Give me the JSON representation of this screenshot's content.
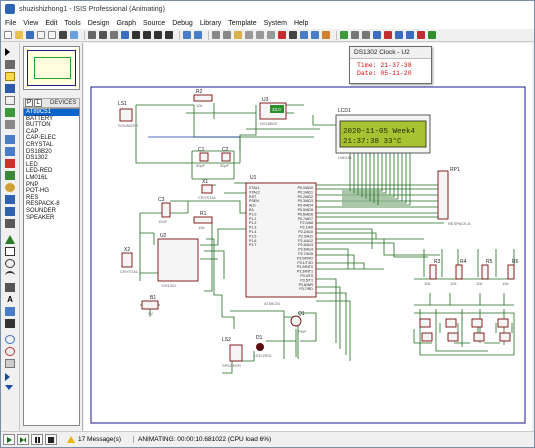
{
  "window": {
    "title": "shuzishizhong1 - ISIS Professional (Animating)"
  },
  "menu": [
    "File",
    "View",
    "Edit",
    "Tools",
    "Design",
    "Graph",
    "Source",
    "Debug",
    "Library",
    "Template",
    "System",
    "Help"
  ],
  "device_panel": {
    "p_label": "P",
    "l_label": "L",
    "title": "DEVICES",
    "items": [
      "AT89C51",
      "BATTERY",
      "BUTTON",
      "CAP",
      "CAP-ELEC",
      "CRYSTAL",
      "DS18B20",
      "DS1302",
      "LED",
      "LED-RED",
      "LM016L",
      "PNP",
      "POT-HG",
      "RES",
      "RESPACK-8",
      "SOUNDER",
      "SPEAKER"
    ],
    "selected": "AT89C51"
  },
  "popup": {
    "title": "DS1302 Clock - U2",
    "time_line": "Time: 21-37-38",
    "date_line": "Date: 05-11-20"
  },
  "lcd": {
    "label": "LCD1",
    "part": "LM016L",
    "line1": "2020-11-05 Week4",
    "line2": "21:37:38    33°C"
  },
  "components": {
    "ls1": "LS1",
    "ls1_part": "SOUNDER",
    "r2": "R2",
    "r2_val": "10k",
    "u3": "U3",
    "u3_part": "DS18B20",
    "u3_reading": "33.0",
    "u1": "U1",
    "u1_part": "AT89C51",
    "u2": "U2",
    "u2_part": "DS1302",
    "x1": "X1",
    "x1_part": "CRYSTAL",
    "x2": "X2",
    "x2_part": "CRYSTAL",
    "c1": "C1",
    "c1_val": "30pF",
    "c2": "C2",
    "c2_val": "30pF",
    "c3": "C3",
    "c3_val": "10uF",
    "r1": "R1",
    "r1_val": "10k",
    "b1": "B1",
    "b1_val": "3V",
    "ls2": "LS2",
    "ls2_part": "SPEAKER",
    "d1": "D1",
    "d1_part": "LED-RED",
    "q1": "Q1",
    "q1_part": "PNP",
    "rp1": "RP1",
    "rp1_part": "RESPACK-8",
    "r3": "R3",
    "r4": "R4",
    "r5": "R5",
    "r6": "R6",
    "res_val": "10k"
  },
  "u1_pins_left": [
    "XTAL1",
    "XTAL2",
    "RST",
    "PSEN",
    "ALE",
    "EA",
    "P1.0",
    "P1.1",
    "P1.2",
    "P1.3",
    "P1.4",
    "P1.5",
    "P1.6",
    "P1.7"
  ],
  "u1_pins_right": [
    "P0.0/AD0",
    "P0.1/AD1",
    "P0.2/AD2",
    "P0.3/AD3",
    "P0.4/AD4",
    "P0.5/AD5",
    "P0.6/AD6",
    "P0.7/AD7",
    "P2.0/A8",
    "P2.1/A9",
    "P2.2/A10",
    "P2.3/A11",
    "P2.4/A12",
    "P2.5/A13",
    "P2.6/A14",
    "P2.7/A15",
    "P3.0/RXD",
    "P3.1/TXD",
    "P3.2/INT0",
    "P3.3/INT1",
    "P3.4/T0",
    "P3.5/T1",
    "P3.6/WR",
    "P3.7/RD"
  ],
  "status": {
    "messages": "17 Message(s)",
    "animating": "ANIMATING: 00:00:10.681022 (CPU load 6%)"
  },
  "colors": {
    "wire": "#1e6b1e",
    "component": "#7a0b0b",
    "border": "#1a1a8c",
    "lcd_bg": "#a9c232",
    "selected": "#0a64cd"
  }
}
